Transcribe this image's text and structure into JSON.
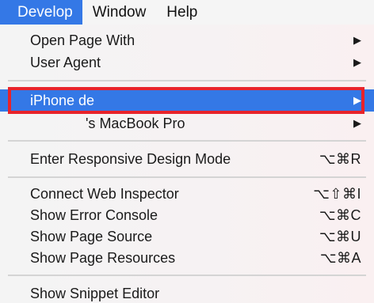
{
  "menubar": {
    "items": [
      {
        "label": "Develop",
        "active": true
      },
      {
        "label": "Window",
        "active": false
      },
      {
        "label": "Help",
        "active": false
      }
    ]
  },
  "menu": {
    "open_page_with": "Open Page With",
    "user_agent": "User Agent",
    "iphone": "iPhone de",
    "macbook": "'s MacBook Pro",
    "responsive": "Enter Responsive Design Mode",
    "responsive_shortcut": "⌥⌘R",
    "connect_inspector": "Connect Web Inspector",
    "connect_inspector_shortcut": "⌥⇧⌘I",
    "error_console": "Show Error Console",
    "error_console_shortcut": "⌥⌘C",
    "page_source": "Show Page Source",
    "page_source_shortcut": "⌥⌘U",
    "page_resources": "Show Page Resources",
    "page_resources_shortcut": "⌥⌘A",
    "snippet_editor": "Show Snippet Editor",
    "submenu_arrow": "▶"
  },
  "colors": {
    "highlight": "#3478e6",
    "annotation": "#e8232a"
  }
}
